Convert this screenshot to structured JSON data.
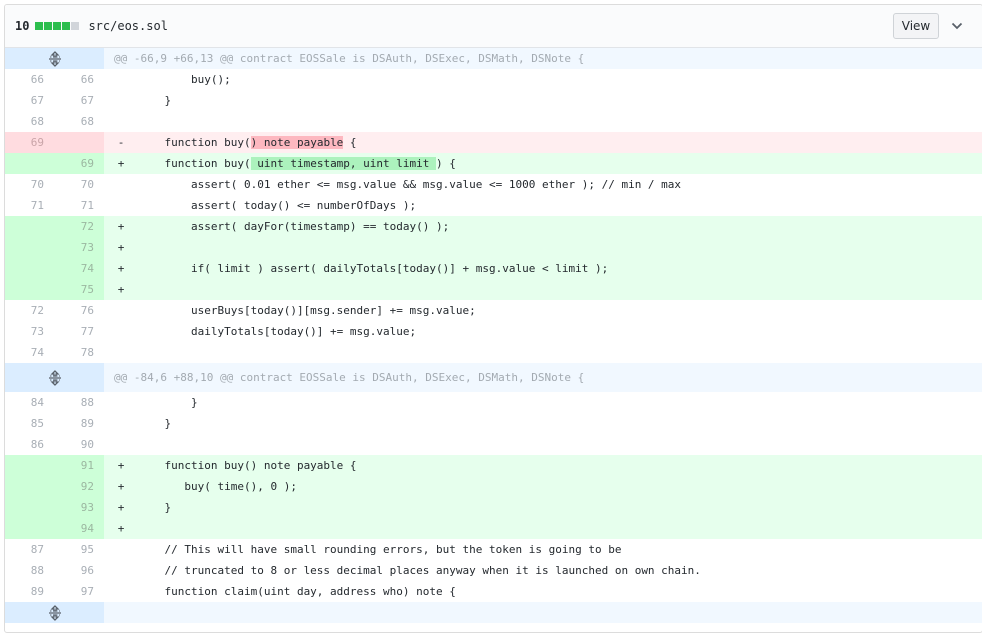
{
  "header": {
    "change_count": "10",
    "file_path": "src/eos.sol",
    "view_label": "View",
    "diffstat_colors": [
      "#2cbe4e",
      "#2cbe4e",
      "#2cbe4e",
      "#2cbe4e",
      "#d1d5da"
    ]
  },
  "hunks": [
    {
      "text": "@@ -66,9 +66,13 @@ contract EOSSale is DSAuth, DSExec, DSMath, DSNote {"
    },
    {
      "text": "@@ -84,6 +88,10 @@ contract EOSSale is DSAuth, DSExec, DSMath, DSNote {"
    }
  ],
  "lines": [
    {
      "type": "ctx",
      "old": "66",
      "new": "66",
      "marker": "",
      "code": "        buy();"
    },
    {
      "type": "ctx",
      "old": "67",
      "new": "67",
      "marker": "",
      "code": "    }"
    },
    {
      "type": "ctx",
      "old": "68",
      "new": "68",
      "marker": "",
      "code": ""
    },
    {
      "type": "del",
      "old": "69",
      "new": "",
      "marker": "-",
      "code_pre": "    function buy(",
      "code_hl": ") note payable",
      "code_post": " {"
    },
    {
      "type": "add",
      "old": "",
      "new": "69",
      "marker": "+",
      "code_pre": "    function buy(",
      "code_hl": " uint timestamp, uint limit ",
      "code_post": ") {"
    },
    {
      "type": "ctx",
      "old": "70",
      "new": "70",
      "marker": "",
      "code": "        assert( 0.01 ether <= msg.value && msg.value <= 1000 ether ); // min / max"
    },
    {
      "type": "ctx",
      "old": "71",
      "new": "71",
      "marker": "",
      "code": "        assert( today() <= numberOfDays );"
    },
    {
      "type": "add",
      "old": "",
      "new": "72",
      "marker": "+",
      "code": "        assert( dayFor(timestamp) == today() );"
    },
    {
      "type": "add",
      "old": "",
      "new": "73",
      "marker": "+",
      "code": ""
    },
    {
      "type": "add",
      "old": "",
      "new": "74",
      "marker": "+",
      "code": "        if( limit ) assert( dailyTotals[today()] + msg.value < limit );"
    },
    {
      "type": "add",
      "old": "",
      "new": "75",
      "marker": "+",
      "code": ""
    },
    {
      "type": "ctx",
      "old": "72",
      "new": "76",
      "marker": "",
      "code": "        userBuys[today()][msg.sender] += msg.value;"
    },
    {
      "type": "ctx",
      "old": "73",
      "new": "77",
      "marker": "",
      "code": "        dailyTotals[today()] += msg.value;"
    },
    {
      "type": "ctx",
      "old": "74",
      "new": "78",
      "marker": "",
      "code": ""
    },
    {
      "type": "ctx",
      "old": "84",
      "new": "88",
      "marker": "",
      "code": "        }"
    },
    {
      "type": "ctx",
      "old": "85",
      "new": "89",
      "marker": "",
      "code": "    }"
    },
    {
      "type": "ctx",
      "old": "86",
      "new": "90",
      "marker": "",
      "code": ""
    },
    {
      "type": "add",
      "old": "",
      "new": "91",
      "marker": "+",
      "code": "    function buy() note payable {"
    },
    {
      "type": "add",
      "old": "",
      "new": "92",
      "marker": "+",
      "code": "       buy( time(), 0 );"
    },
    {
      "type": "add",
      "old": "",
      "new": "93",
      "marker": "+",
      "code": "    }"
    },
    {
      "type": "add",
      "old": "",
      "new": "94",
      "marker": "+",
      "code": ""
    },
    {
      "type": "ctx",
      "old": "87",
      "new": "95",
      "marker": "",
      "code": "    // This will have small rounding errors, but the token is going to be"
    },
    {
      "type": "ctx",
      "old": "88",
      "new": "96",
      "marker": "",
      "code": "    // truncated to 8 or less decimal places anyway when it is launched on own chain."
    },
    {
      "type": "ctx",
      "old": "89",
      "new": "97",
      "marker": "",
      "code": "    function claim(uint day, address who) note {"
    }
  ],
  "icons": {
    "expand": "expand-icon",
    "chevron": "chevron-down-icon"
  }
}
